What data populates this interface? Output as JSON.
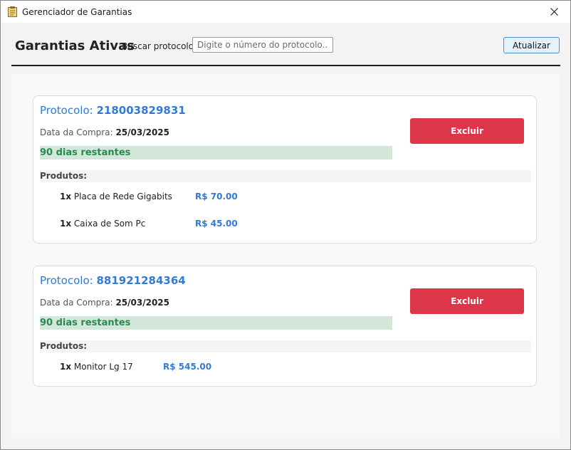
{
  "window": {
    "title": "Gerenciador de Garantias"
  },
  "header": {
    "title": "Garantias Ativas",
    "search_label": "Buscar protocolo:",
    "search_placeholder": "Digite o número do protocolo...",
    "search_value": "",
    "refresh_label": "Atualizar"
  },
  "warranties": [
    {
      "protocol_label": "Protocolo: ",
      "protocol": "218003829831",
      "date_label": "Data da Compra: ",
      "date": "25/03/2025",
      "remaining": "90 dias restantes",
      "delete_label": "Excluir",
      "products_label": "Produtos:",
      "products": [
        {
          "qty": "1x",
          "name": "Placa de Rede Gigabits",
          "price": "R$ 70.00"
        },
        {
          "qty": "1x",
          "name": "Caixa de Som Pc",
          "price": "R$ 45.00"
        }
      ]
    },
    {
      "protocol_label": "Protocolo: ",
      "protocol": "881921284364",
      "date_label": "Data da Compra: ",
      "date": "25/03/2025",
      "remaining": "90 dias restantes",
      "delete_label": "Excluir",
      "products_label": "Produtos:",
      "products": [
        {
          "qty": "1x",
          "name": "Monitor Lg 17",
          "price": "R$ 545.00"
        }
      ]
    }
  ]
}
